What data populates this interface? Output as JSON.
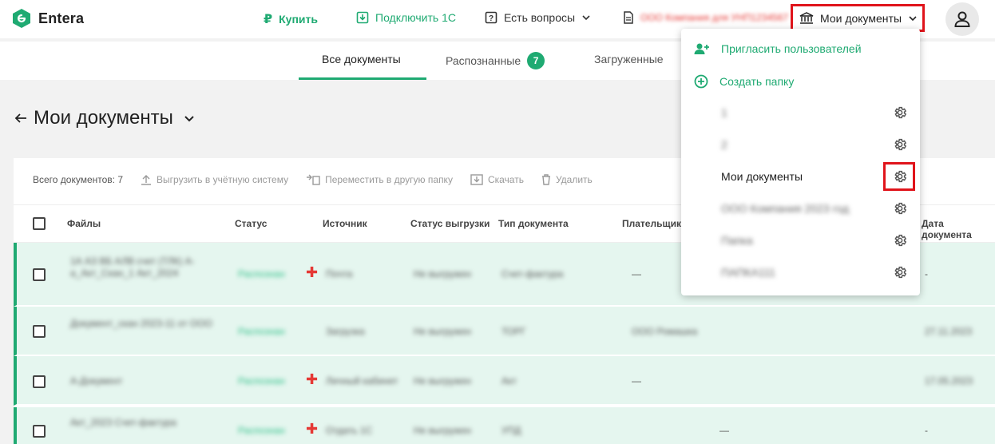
{
  "header": {
    "logo": "Entera",
    "buy": "Купить",
    "connect": "Подключить 1С",
    "questions": "Есть вопросы",
    "org_blurred": "ООО Компания для УНП1234567",
    "mydocs": "Мои документы"
  },
  "tabs": [
    {
      "label": "Все документы"
    },
    {
      "label": "Распознанные",
      "badge": "7"
    },
    {
      "label": "Загруженные"
    }
  ],
  "page": {
    "title": "Мои документы"
  },
  "toolbar": {
    "total": "Всего документов: 7",
    "export": "Выгрузить в учётную систему",
    "move": "Переместить в другую папку",
    "download": "Скачать",
    "delete": "Удалить"
  },
  "columns": [
    "Файлы",
    "Статус",
    "Источник",
    "Статус выгрузки",
    "Тип документа",
    "Плательщик",
    "Дата документа"
  ],
  "rows": [
    {
      "file": "1А АЗ ВБ АЛВ счет (ТЛК) А-а_Акт_Скан_1 Акт_2024",
      "status": "Распознан",
      "source": "Почта",
      "export": "Не выгружен",
      "type": "Счет-фактура",
      "payer": "—",
      "date": "-"
    },
    {
      "file": "Документ_скан 2023-11 от ООО",
      "status": "Распознан",
      "source": "Загрузка",
      "export": "Не выгружен",
      "type": "ТОРГ",
      "payer": "ООО Ромашка",
      "date": "27.11.2023"
    },
    {
      "file": "А-Документ",
      "status": "Распознан",
      "source": "Личный кабинет",
      "export": "Не выгружен",
      "type": "Акт",
      "payer": "—",
      "date": "17.05.2023"
    },
    {
      "file": "Акт_2023 Счет-фактура",
      "status": "Распознан",
      "source": "Отдать 1С",
      "export": "Не выгружен",
      "type": "УПД",
      "payer": "—",
      "date": "-"
    }
  ],
  "dropdown": {
    "invite": "Пригласить пользователей",
    "create_folder": "Создать папку",
    "folders": [
      {
        "name": "1",
        "blurred": true
      },
      {
        "name": "2",
        "blurred": true
      },
      {
        "name": "Мои документы",
        "blurred": false
      },
      {
        "name": "ООО Компания 2023 год",
        "blurred": true
      },
      {
        "name": "Папка",
        "blurred": true
      },
      {
        "name": "ПАПКА111",
        "blurred": true
      }
    ]
  },
  "colors": {
    "accent": "#1faa72",
    "highlight": "#e0141b"
  }
}
